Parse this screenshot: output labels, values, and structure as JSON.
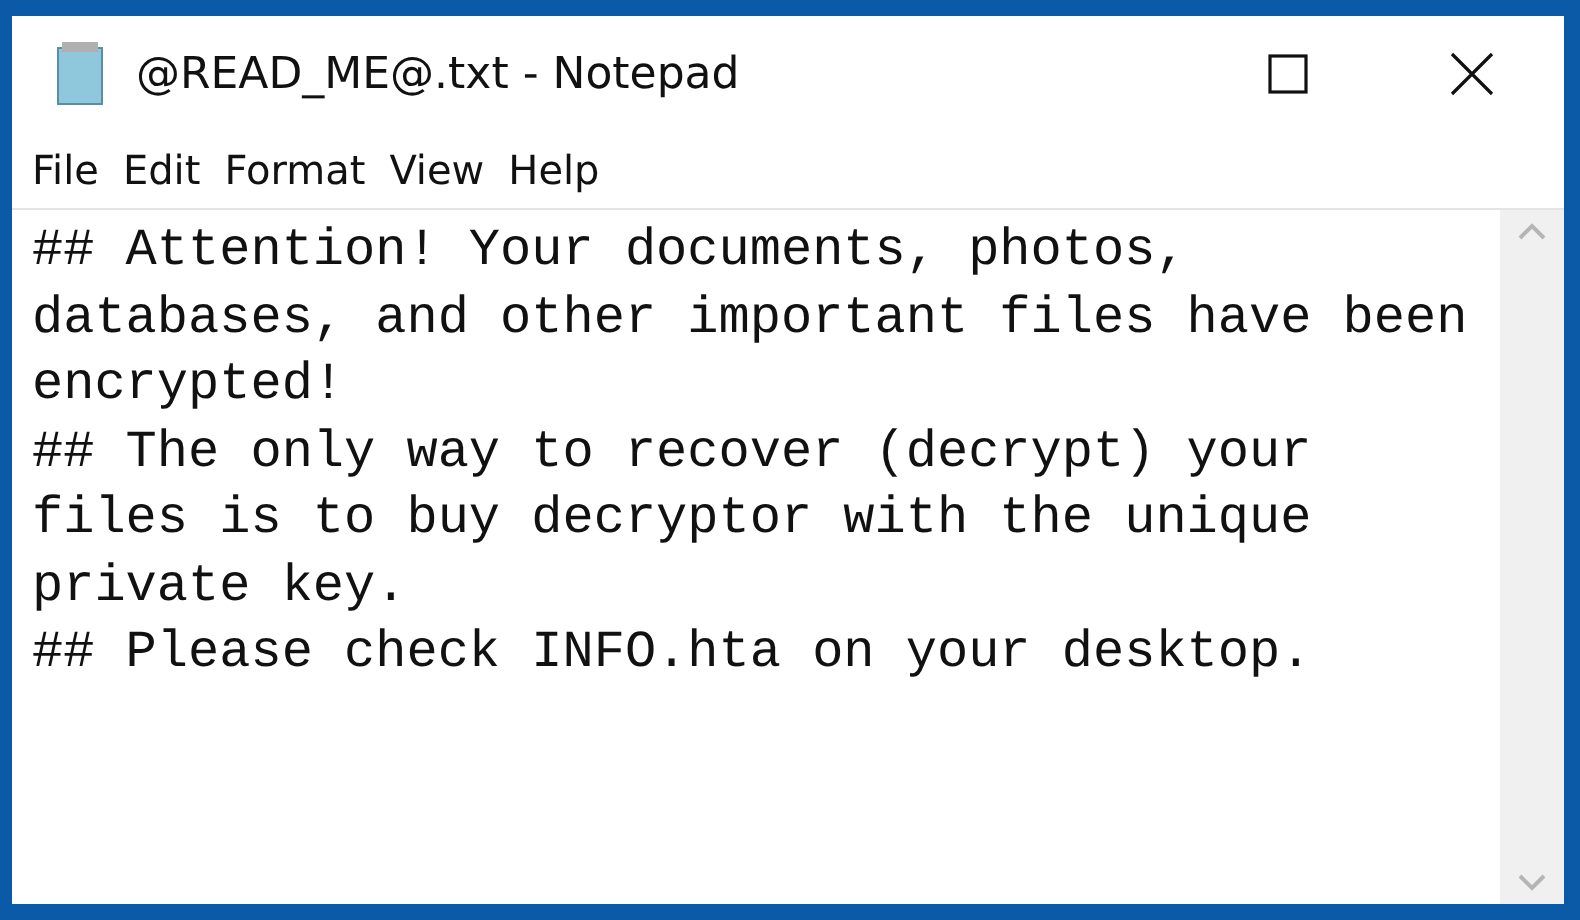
{
  "window": {
    "title": "@READ_ME@.txt - Notepad"
  },
  "menu": [
    "File",
    "Edit",
    "Format",
    "View",
    "Help"
  ],
  "editor": {
    "lines": [
      "## Attention! Your documents, photos,",
      "databases, and other important files have been",
      "encrypted!",
      "## The only way to recover (decrypt) your",
      "files is to buy decryptor with the unique",
      "private key.",
      "## Please check INFO.hta on your desktop."
    ]
  }
}
